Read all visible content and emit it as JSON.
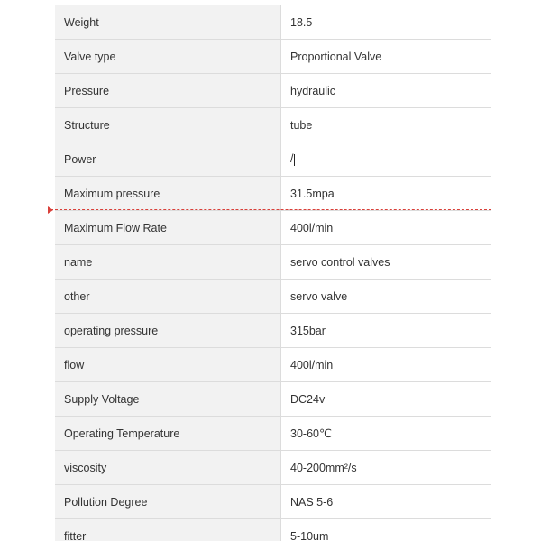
{
  "spec_rows": [
    {
      "label": "Weight",
      "value": "18.5"
    },
    {
      "label": "Valve type",
      "value": "Proportional Valve"
    },
    {
      "label": "Pressure",
      "value": "hydraulic"
    },
    {
      "label": "Structure",
      "value": "tube"
    },
    {
      "label": "Power",
      "value": "/"
    },
    {
      "label": "Maximum pressure",
      "value": "31.5mpa"
    },
    {
      "label": "Maximum Flow Rate",
      "value": "400l/min"
    },
    {
      "label": "name",
      "value": "servo control valves"
    },
    {
      "label": "other",
      "value": "servo valve"
    },
    {
      "label": "operating pressure",
      "value": "315bar"
    },
    {
      "label": "flow",
      "value": "400l/min"
    },
    {
      "label": "Supply Voltage",
      "value": "DC24v"
    },
    {
      "label": "Operating Temperature",
      "value": "30-60℃"
    },
    {
      "label": "viscosity",
      "value": "40-200mm²/s"
    },
    {
      "label": "Pollution Degree",
      "value": "NAS 5-6"
    },
    {
      "label": "fitter",
      "value": "5-10um"
    }
  ],
  "guide": {
    "icon": "arrow-marker-icon",
    "color": "#d9403a"
  }
}
